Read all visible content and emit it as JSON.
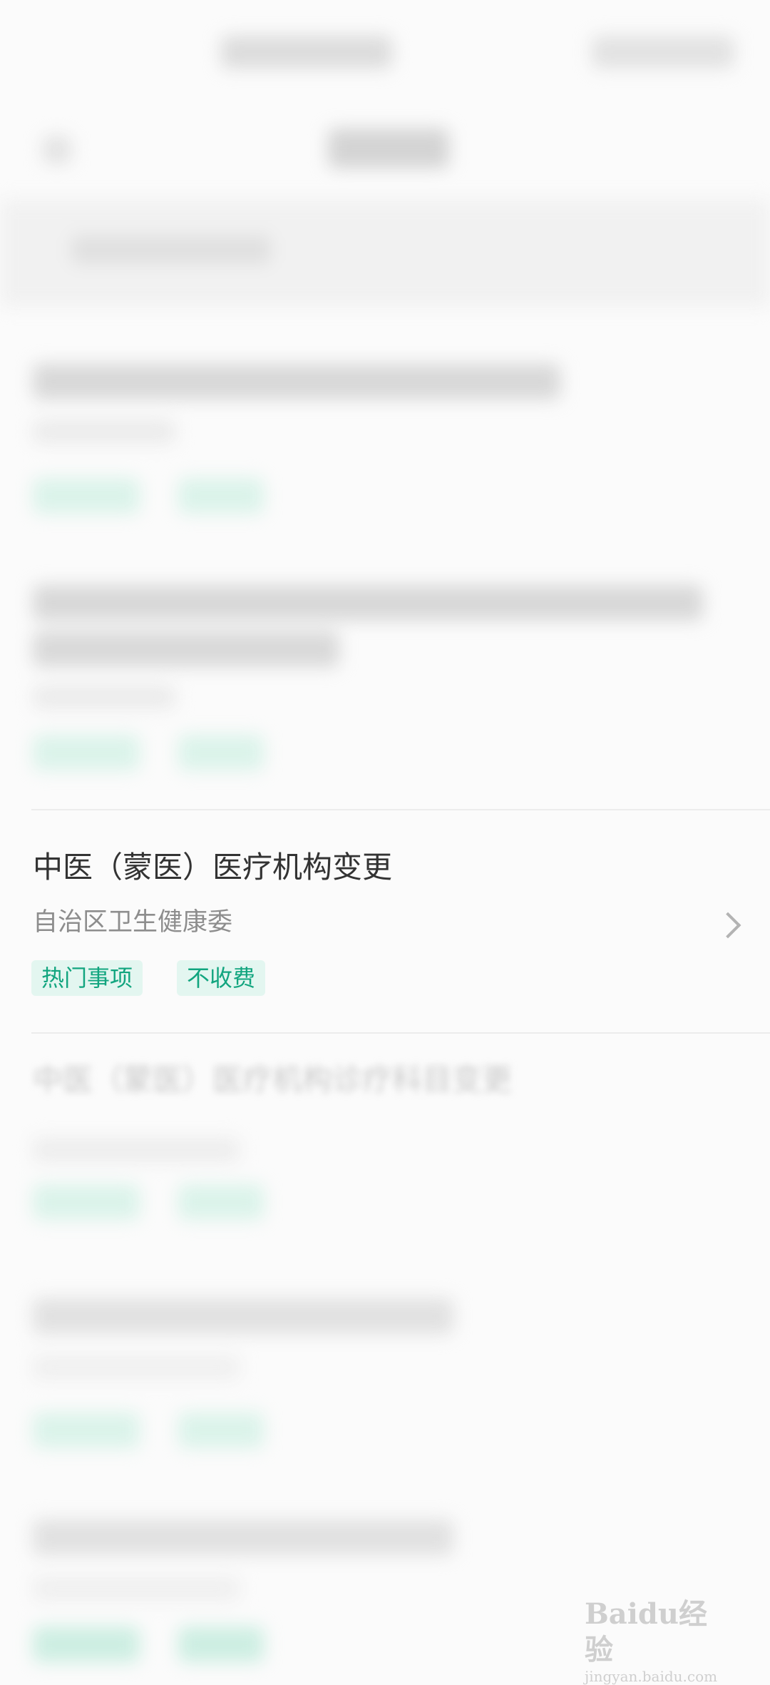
{
  "focused_item": {
    "title": "中医（蒙医）医疗机构变更",
    "department": "自治区卫生健康委",
    "tags": [
      "热门事项",
      "不收费"
    ]
  },
  "blurred_item_next": {
    "title": "中医（蒙医）医疗机构诊疗科目变更"
  },
  "watermark": {
    "brand": "Baidu经验",
    "url": "jingyan.baidu.com"
  },
  "icons": {
    "chevron": "chevron-right-icon"
  },
  "colors": {
    "tag_bg": "#e3f6f0",
    "tag_text": "#12a57f",
    "title": "#333333",
    "subtitle": "#8d8d8d"
  }
}
